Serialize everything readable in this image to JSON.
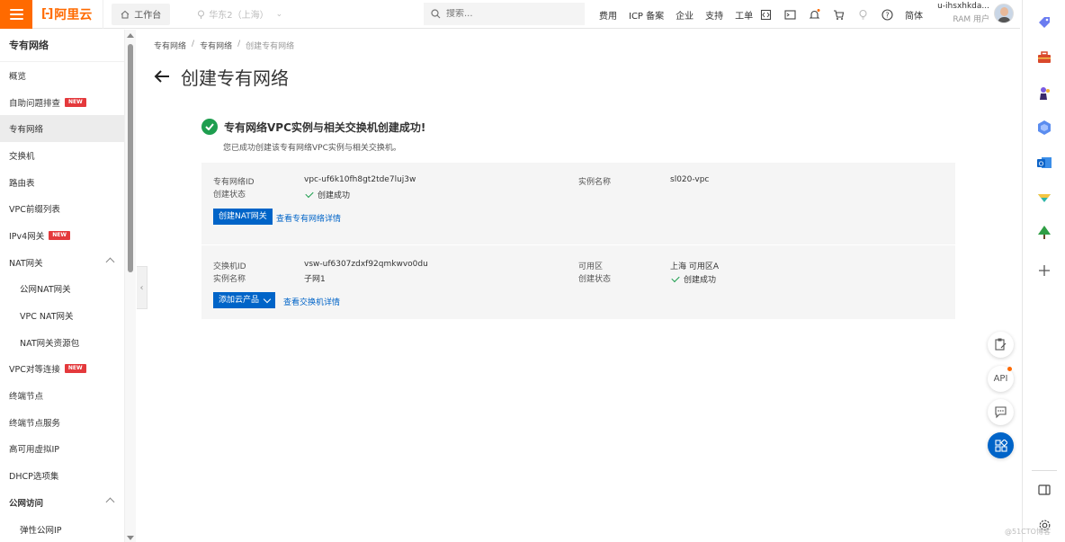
{
  "topbar": {
    "logo_text": "阿里云",
    "workbench": "工作台",
    "region": "华东2（上海）",
    "search_placeholder": "搜索...",
    "links": [
      "费用",
      "ICP 备案",
      "企业",
      "支持",
      "工单"
    ],
    "language": "简体",
    "user_name": "u-ihsxhkda...",
    "user_role": "RAM 用户"
  },
  "sidebar": {
    "title": "专有网络",
    "items": [
      {
        "label": "概览"
      },
      {
        "label": "自助问题排查",
        "badge": "NEW"
      },
      {
        "label": "专有网络"
      },
      {
        "label": "交换机"
      },
      {
        "label": "路由表"
      },
      {
        "label": "VPC前缀列表"
      },
      {
        "label": "IPv4网关",
        "badge": "NEW"
      },
      {
        "label": "NAT网关"
      },
      {
        "label": "公网NAT网关"
      },
      {
        "label": "VPC NAT网关"
      },
      {
        "label": "NAT网关资源包"
      },
      {
        "label": "VPC对等连接",
        "badge": "NEW"
      },
      {
        "label": "终端节点"
      },
      {
        "label": "终端节点服务"
      },
      {
        "label": "高可用虚拟IP"
      },
      {
        "label": "DHCP选项集"
      },
      {
        "label": "公网访问"
      },
      {
        "label": "弹性公网IP"
      }
    ]
  },
  "breadcrumb": [
    "专有网络",
    "专有网络",
    "创建专有网络"
  ],
  "page": {
    "title": "创建专有网络",
    "success_title": "专有网络VPC实例与相关交换机创建成功!",
    "success_sub": "您已成功创建该专有网络VPC实例与相关交换机。"
  },
  "vpc": {
    "id_label": "专有网络ID",
    "id_value": "vpc-uf6k10fh8gt2tde7luj3w",
    "status_label": "创建状态",
    "status_value": "创建成功",
    "name_label": "实例名称",
    "name_value": "sl020-vpc",
    "create_nat_btn": "创建NAT网关",
    "detail_link": "查看专有网络详情"
  },
  "vswitch": {
    "id_label": "交换机ID",
    "id_value": "vsw-uf6307zdxf92qmkwvo0du",
    "name_label": "实例名称",
    "name_value": "子网1",
    "zone_label": "可用区",
    "zone_value": "上海 可用区A",
    "status_label": "创建状态",
    "status_value": "创建成功",
    "add_product_btn": "添加云产品",
    "detail_link": "查看交换机详情"
  },
  "watermark": "@51CTO博客",
  "colors": {
    "brand": "#ff6a00",
    "primary": "#0064c8",
    "success": "#1e9e4f",
    "new_badge": "#e4393c"
  }
}
